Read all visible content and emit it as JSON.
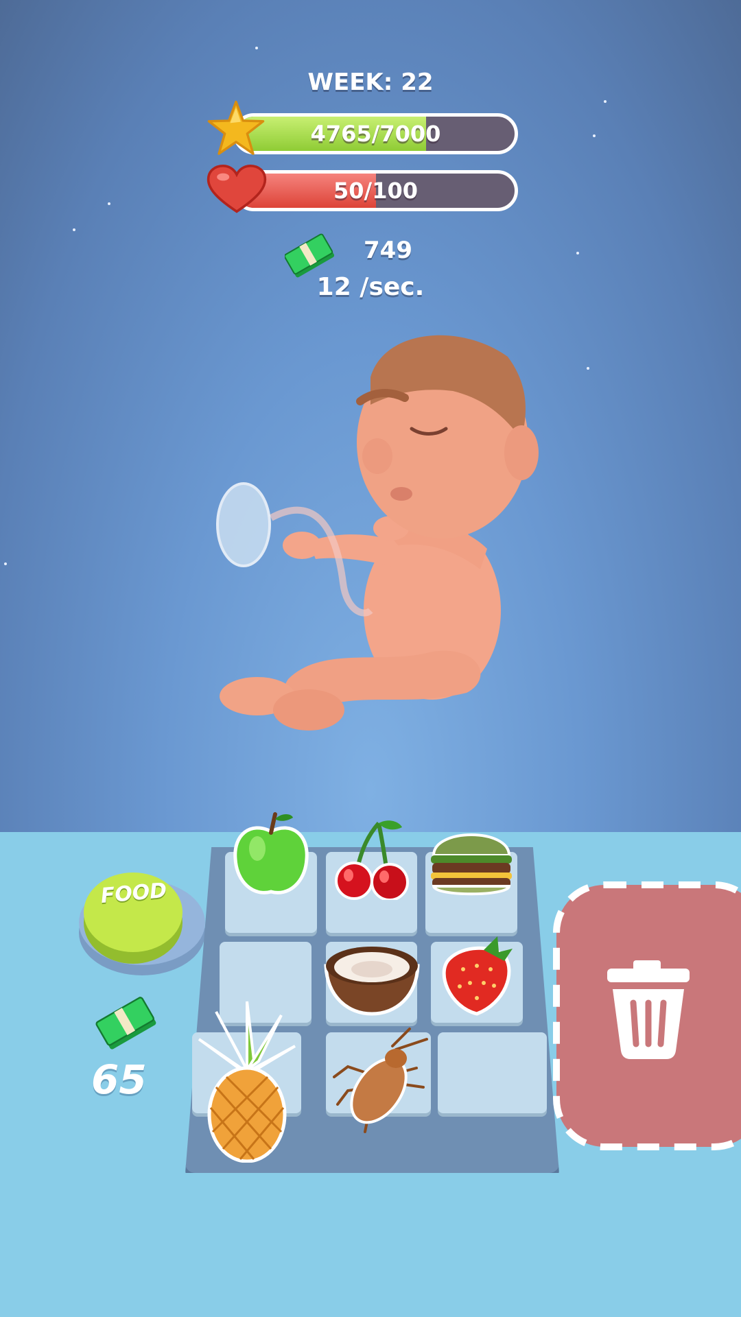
{
  "hud": {
    "week_label": "WEEK: 22",
    "xp": {
      "text": "4765/7000",
      "current": 4765,
      "max": 7000,
      "icon": "star-icon",
      "color": "#9fd63e"
    },
    "health": {
      "text": "50/100",
      "current": 50,
      "max": 100,
      "icon": "heart-icon",
      "color": "#e0463c"
    },
    "money": {
      "icon": "cash-icon",
      "amount": "749"
    },
    "income_rate": "12 /sec."
  },
  "shop": {
    "button_label": "FOOD",
    "price_icon": "cash-icon",
    "price": "65"
  },
  "grid": {
    "rows": 3,
    "cols": 3,
    "cells": [
      "apple",
      "cherries",
      "burger",
      "",
      "coconut",
      "strawberry",
      "pineapple",
      "cockroach",
      ""
    ]
  },
  "trash": {
    "icon": "trash-icon"
  }
}
